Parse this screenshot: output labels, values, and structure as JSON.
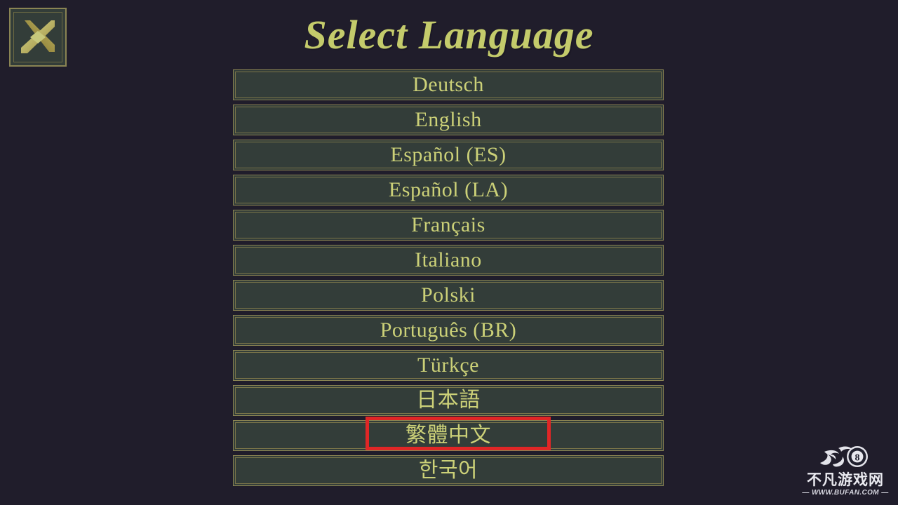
{
  "screen": {
    "background_color": "#201d2b",
    "title": "Select Language",
    "title_color": "#c4cb6b"
  },
  "close_button": {
    "icon": "close-x-icon",
    "label": "Close",
    "fill_color": "#333d39",
    "border_color": "#8a8453",
    "x_color": "#c9c87a"
  },
  "language_list": {
    "row_fill_color": "#333d39",
    "row_border_color": "#8a8453",
    "text_color": "#ccd178",
    "items": [
      {
        "label": "Deutsch",
        "script": "latin"
      },
      {
        "label": "English",
        "script": "latin"
      },
      {
        "label": "Español (ES)",
        "script": "latin"
      },
      {
        "label": "Español (LA)",
        "script": "latin"
      },
      {
        "label": "Français",
        "script": "latin"
      },
      {
        "label": "Italiano",
        "script": "latin"
      },
      {
        "label": "Polski",
        "script": "latin"
      },
      {
        "label": "Português (BR)",
        "script": "latin"
      },
      {
        "label": "Türkçe",
        "script": "latin"
      },
      {
        "label": "日本語",
        "script": "cjk"
      },
      {
        "label": "繁體中文",
        "script": "cjk"
      },
      {
        "label": "한국어",
        "script": "cjk"
      }
    ]
  },
  "selection_highlight": {
    "target_label": "繁體中文",
    "target_index": 10,
    "color": "#e02626"
  },
  "watermark": {
    "logo": "flaming-8-ball-logo",
    "site_name": "不凡游戏网",
    "url": "— WWW.BUFAN.COM —"
  }
}
